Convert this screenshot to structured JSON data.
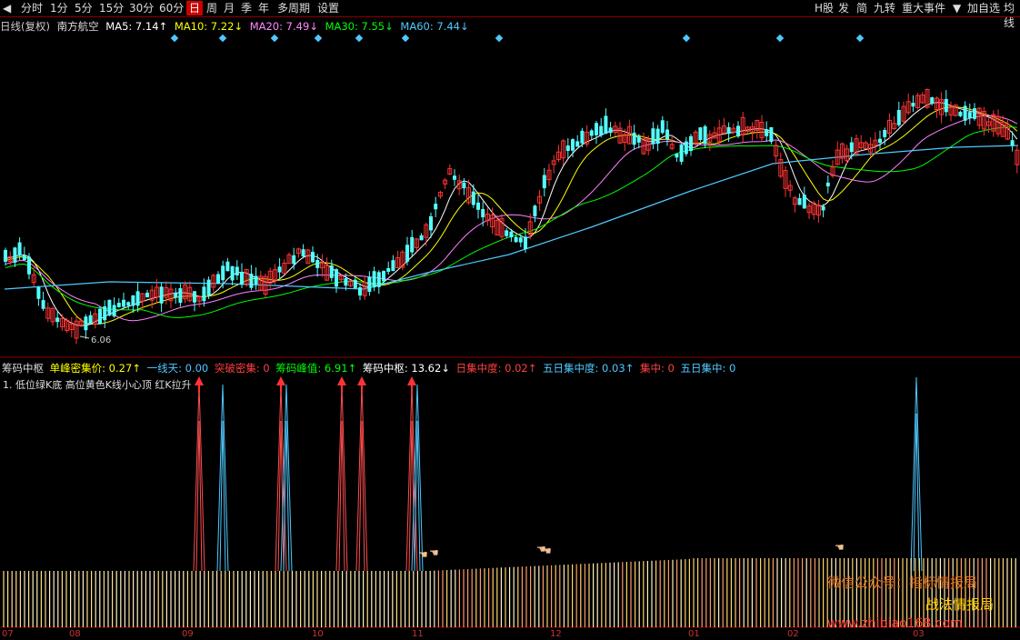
{
  "toolbar": {
    "left_tabs": [
      "分时",
      "1分",
      "5分",
      "15分",
      "30分",
      "60分",
      "日",
      "周",
      "月",
      "季",
      "年",
      "多周期",
      "设置"
    ],
    "active_tab": "日",
    "right_tabs": [
      "H股",
      "发",
      "简",
      "九转",
      "重大事件",
      "加自选",
      "均线"
    ]
  },
  "info_line": {
    "period": "日线(复权)",
    "stock": "南方航空",
    "ma5": "MA5: 7.14↑",
    "ma10": "MA10: 7.22↓",
    "ma20": "MA20: 7.49↓",
    "ma30": "MA30: 7.55↓",
    "ma60": "MA60: 7.44↓"
  },
  "low_label": "6.06",
  "indicator_line": {
    "name": "筹码中枢",
    "single_peak": "单峰密集价: 0.27↑",
    "one_line": "一线天: 0.00",
    "breakout": "突破密集: 0",
    "peak_value": "筹码峰值: 6.91↑",
    "center": "筹码中枢: 13.62↓",
    "day_conc": "日集中度: 0.02↑",
    "five_day_conc": "五日集中度: 0.03↑",
    "conc": "集中: 0",
    "five_day": "五日集中: 0"
  },
  "note": "1. 低位绿K底 高位黄色K线小心顶 红K拉升",
  "date_labels": [
    "07",
    "08",
    "09",
    "10",
    "11",
    "12",
    "01",
    "02",
    "03"
  ],
  "watermark": {
    "line1": "微信公众号：指标情报局",
    "line2": "战法情报局",
    "line3": "www.zhibiao168.com"
  },
  "colors": {
    "up": "#ff3333",
    "down": "#54ffff",
    "ma5": "#ffffff",
    "ma10": "#ffff00",
    "ma20": "#ff80ff",
    "ma30": "#00ff00",
    "ma60": "#4fc8ff"
  }
}
